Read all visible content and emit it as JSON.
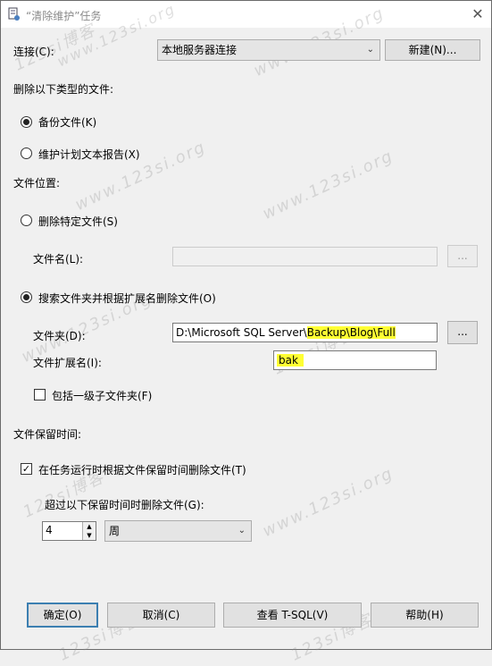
{
  "window": {
    "title": "“清除维护”任务",
    "close_glyph": "✕"
  },
  "connection": {
    "label": "连接(C):",
    "selected": "本地服务器连接",
    "new_button": "新建(N)..."
  },
  "delete_types": {
    "heading": "删除以下类型的文件:",
    "option_backup": "备份文件(K)",
    "option_report": "维护计划文本报告(X)"
  },
  "file_location": {
    "heading": "文件位置:",
    "option_specific": "删除特定文件(S)",
    "filename_label": "文件名(L):",
    "filename_value": "",
    "browse1": "...",
    "option_search": "搜索文件夹并根据扩展名删除文件(O)",
    "folder_label": "文件夹(D):",
    "folder_value_prefix": "D:\\Microsoft SQL Server\\",
    "folder_value_highlight": "Backup\\Blog\\Full",
    "browse2": "...",
    "ext_label": "文件扩展名(I):",
    "ext_value": "bak",
    "include_sub": "包括一级子文件夹(F)"
  },
  "retention": {
    "heading": "文件保留时间:",
    "delete_by_age": "在任务运行时根据文件保留时间删除文件(T)",
    "older_than_label": "超过以下保留时间时删除文件(G):",
    "number_value": "4",
    "unit_selected": "周"
  },
  "buttons": {
    "ok": "确定(O)",
    "cancel": "取消(C)",
    "view_tsql": "查看 T-SQL(V)",
    "help": "帮助(H)"
  },
  "watermark": {
    "a": "123si博客",
    "b": "www.123si.org"
  },
  "colors": {
    "highlight": "#ffff33",
    "default_button_border": "#3c7fb1"
  }
}
